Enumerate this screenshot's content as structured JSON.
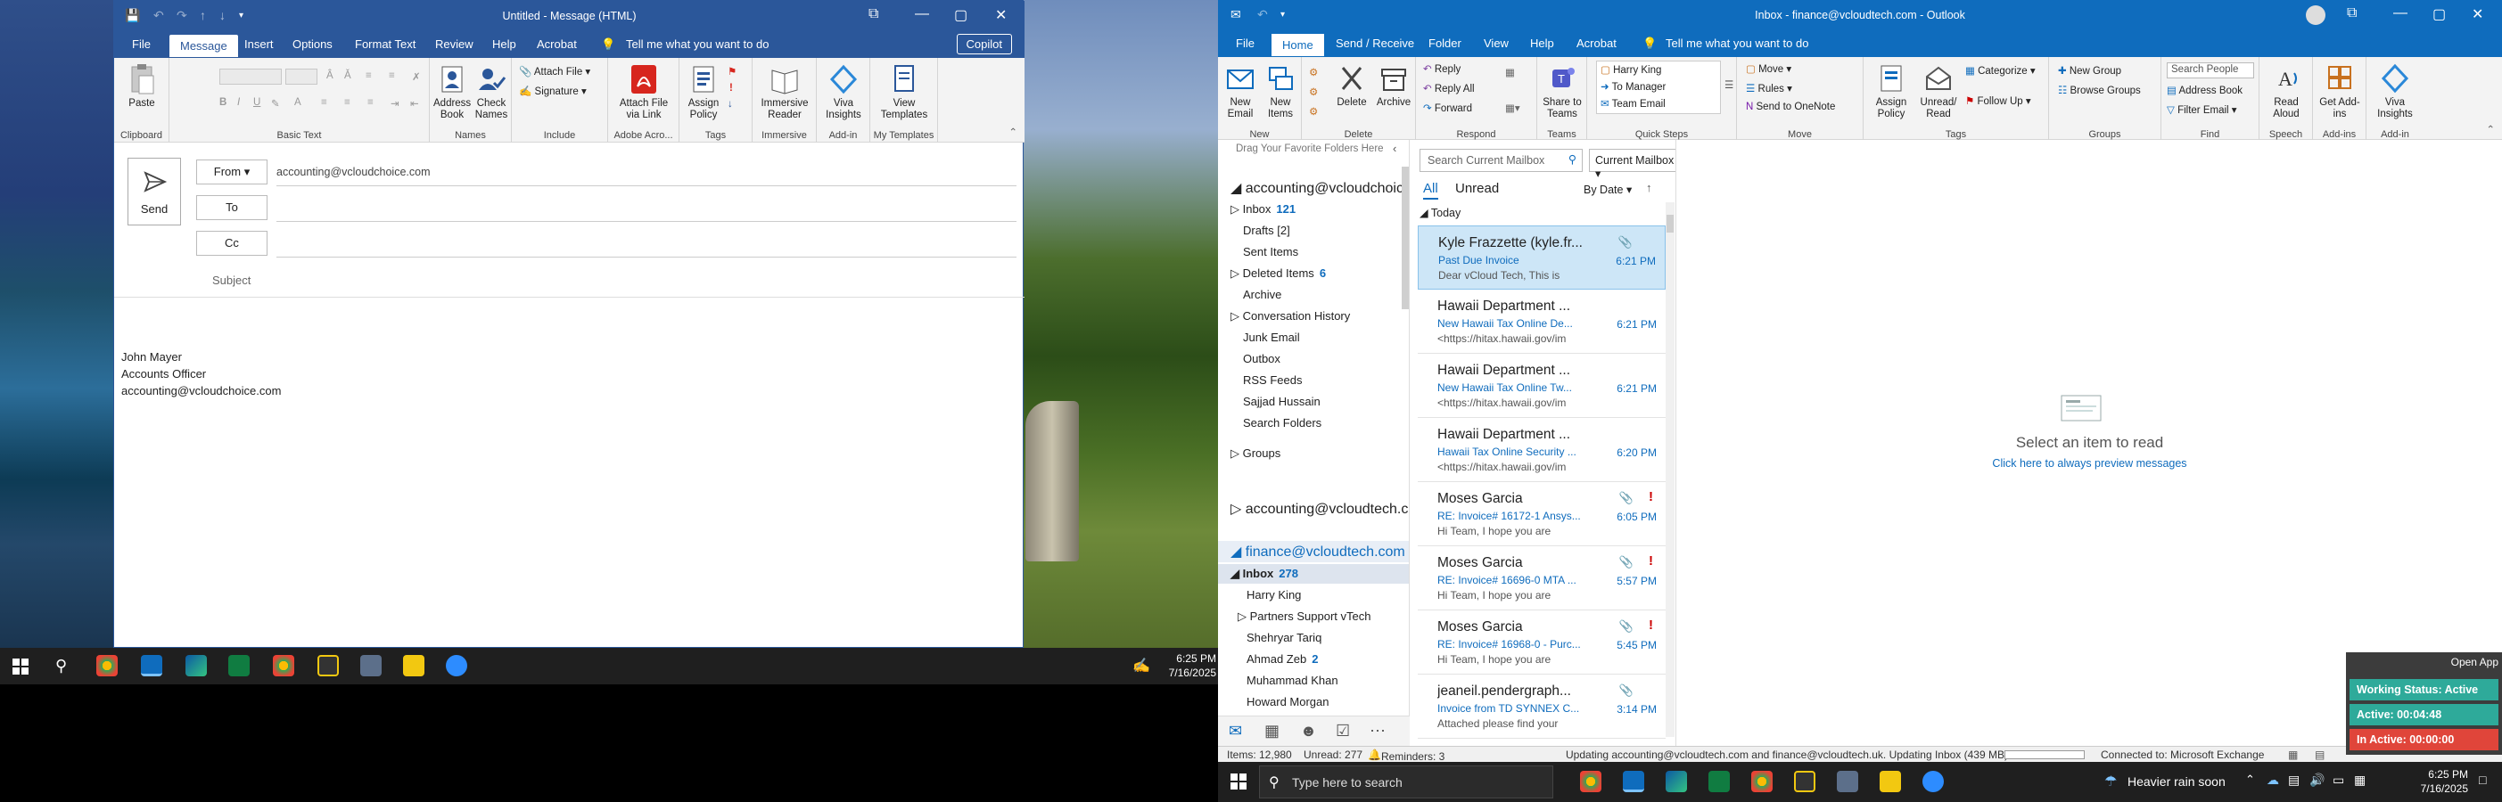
{
  "compose": {
    "title": "Untitled  -  Message (HTML)",
    "tabs": [
      "File",
      "Message",
      "Insert",
      "Options",
      "Format Text",
      "Review",
      "Help",
      "Acrobat"
    ],
    "tell_me": "Tell me what you want to do",
    "copilot": "Copilot",
    "ribbon": {
      "paste": "Paste",
      "clipboard": "Clipboard",
      "basic_text": "Basic Text",
      "address_book": "Address Book",
      "check_names": "Check Names",
      "names": "Names",
      "attach_file": "Attach File",
      "signature": "Signature",
      "include": "Include",
      "attach_via_link": "Attach File via Link",
      "adobe": "Adobe Acro...",
      "assign_policy": "Assign Policy",
      "tags": "Tags",
      "immersive_reader": "Immersive Reader",
      "immersive": "Immersive",
      "viva_insights": "Viva Insights",
      "addin": "Add-in",
      "view_templates": "View Templates",
      "my_templates": "My Templates"
    },
    "send": "Send",
    "from_label": "From",
    "from_value": "accounting@vcloudchoice.com",
    "to_label": "To",
    "cc_label": "Cc",
    "subject_label": "Subject",
    "body": {
      "name": "John Mayer",
      "role": "Accounts Officer",
      "email": "accounting@vcloudchoice.com"
    }
  },
  "taskbar_left": {
    "time": "6:25 PM",
    "date": "7/16/2025"
  },
  "outlook": {
    "title": "Inbox - finance@vcloudtech.com  -  Outlook",
    "tabs": [
      "File",
      "Home",
      "Send / Receive",
      "Folder",
      "View",
      "Help",
      "Acrobat"
    ],
    "tell_me": "Tell me what you want to do",
    "ribbon": {
      "new_email": "New Email",
      "new_items": "New Items",
      "new": "New",
      "delete": "Delete",
      "archive": "Archive",
      "delete_group": "Delete",
      "reply": "Reply",
      "reply_all": "Reply All",
      "forward": "Forward",
      "respond": "Respond",
      "share_teams": "Share to Teams",
      "teams": "Teams",
      "qs1": "Harry King",
      "qs2": "To Manager",
      "qs3": "Team Email",
      "quick_steps": "Quick Steps",
      "move": "Move",
      "rules": "Rules",
      "onenote": "Send to OneNote",
      "move_group": "Move",
      "assign_policy": "Assign Policy",
      "unread_read": "Unread/ Read",
      "categorize": "Categorize",
      "follow_up": "Follow Up",
      "tags": "Tags",
      "new_group": "New Group",
      "browse_groups": "Browse Groups",
      "groups": "Groups",
      "search_people": "Search People",
      "address_book": "Address Book",
      "filter_email": "Filter Email",
      "find": "Find",
      "read_aloud": "Read Aloud",
      "speech": "Speech",
      "get_addins": "Get Add-ins",
      "addins": "Add-ins",
      "viva_insights": "Viva Insights",
      "addin": "Add-in"
    },
    "folders": {
      "drag_hint": "Drag Your Favorite Folders Here",
      "account1": "accounting@vcloudchoic...",
      "inbox": "Inbox",
      "inbox_count": "121",
      "drafts": "Drafts [2]",
      "sent": "Sent Items",
      "deleted": "Deleted Items",
      "deleted_count": "6",
      "archive": "Archive",
      "conversation": "Conversation History",
      "junk": "Junk Email",
      "outbox": "Outbox",
      "rss": "RSS Feeds",
      "sajjad": "Sajjad Hussain",
      "search_folders": "Search Folders",
      "groups": "Groups",
      "account2": "accounting@vcloudtech.c...",
      "account3": "finance@vcloudtech.com",
      "inbox2": "Inbox",
      "inbox2_count": "278",
      "sub1": "Harry King",
      "sub2": "Partners Support vTech",
      "sub3": "Shehryar Tariq",
      "sub4": "Ahmad Zeb",
      "sub4_count": "2",
      "sub5": "Muhammad Khan",
      "sub6": "Howard Morgan"
    },
    "list": {
      "search_placeholder": "Search Current Mailbox",
      "scope": "Current Mailbox",
      "filter_all": "All",
      "filter_unread": "Unread",
      "sort": "By Date",
      "group_today": "Today",
      "items": [
        {
          "from": "Kyle Frazzette (kyle.fr...",
          "subject": "Past Due Invoice",
          "preview": "Dear vCloud Tech,  This is",
          "time": "6:21 PM",
          "attach": true,
          "important": false
        },
        {
          "from": "Hawaii Department ...",
          "subject": "New Hawaii Tax Online De...",
          "preview": "<https://hitax.hawaii.gov/im",
          "time": "6:21 PM",
          "attach": false,
          "important": false
        },
        {
          "from": "Hawaii Department ...",
          "subject": "New Hawaii Tax Online Tw...",
          "preview": "<https://hitax.hawaii.gov/im",
          "time": "6:21 PM",
          "attach": false,
          "important": false
        },
        {
          "from": "Hawaii Department ...",
          "subject": "Hawaii Tax Online Security ...",
          "preview": "<https://hitax.hawaii.gov/im",
          "time": "6:20 PM",
          "attach": false,
          "important": false
        },
        {
          "from": "Moses Garcia",
          "subject": "RE: Invoice# 16172-1 Ansys...",
          "preview": "Hi Team,  I hope you are",
          "time": "6:05 PM",
          "attach": true,
          "important": true
        },
        {
          "from": "Moses Garcia",
          "subject": "RE: Invoice# 16696-0 MTA ...",
          "preview": "Hi Team,  I hope you are",
          "time": "5:57 PM",
          "attach": true,
          "important": true
        },
        {
          "from": "Moses Garcia",
          "subject": "RE: Invoice# 16968-0 - Purc...",
          "preview": "Hi Team,  I hope you are",
          "time": "5:45 PM",
          "attach": true,
          "important": true
        },
        {
          "from": "jeaneil.pendergraph...",
          "subject": "Invoice from TD SYNNEX C...",
          "preview": "Attached please find your",
          "time": "3:14 PM",
          "attach": true,
          "important": false
        }
      ]
    },
    "reading": {
      "empty": "Select an item to read",
      "link": "Click here to always preview messages"
    },
    "status": {
      "items": "Items: 12,980",
      "unread": "Unread: 277",
      "reminders": "Reminders: 3",
      "updating": "Updating accounting@vcloudtech.com and finance@vcloudtech.uk.  Updating Inbox (439 MB).",
      "connected": "Connected to: Microsoft Exchange"
    }
  },
  "widget": {
    "open_app": "Open App",
    "working": "Working Status: Active",
    "active": "Active: 00:04:48",
    "inactive": "In Active: 00:00:00"
  },
  "taskbar_right": {
    "search": "Type here to search",
    "weather": "Heavier rain soon",
    "time": "6:25 PM",
    "date": "7/16/2025"
  },
  "colors": {
    "word_blue": "#2b579a",
    "outlook_blue": "#0f6cbd",
    "status_active": "#2eaa9a",
    "status_inactive": "#e0453a"
  }
}
